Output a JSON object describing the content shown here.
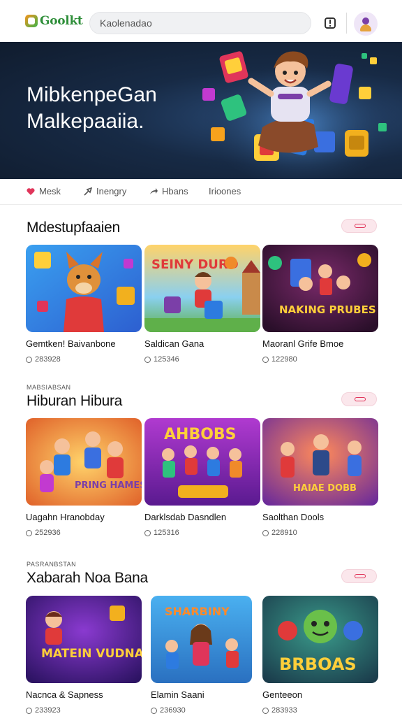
{
  "header": {
    "logo_text": "Goolkt",
    "search_placeholder": "Kaolenadao",
    "notification_icon": "bell-icon",
    "avatar_icon": "user-avatar"
  },
  "hero": {
    "title": "MibkenpeGan",
    "subtitle": "Malkepaaiia."
  },
  "tabs": [
    {
      "label": "Mesk",
      "icon": "heart-icon",
      "color": "#e0355a"
    },
    {
      "label": "Inengry",
      "icon": "arrow-icon",
      "color": "#555555"
    },
    {
      "label": "Hbans",
      "icon": "share-icon",
      "color": "#555555"
    },
    {
      "label": "Irioones",
      "icon": "",
      "color": "#555555"
    }
  ],
  "sections": [
    {
      "kicker": "",
      "title": "Mdestupfaaien",
      "cards": [
        {
          "title": "Gemtken! Baivanbone",
          "stat": "283928"
        },
        {
          "title": "Saldican Gana",
          "stat": "125346"
        },
        {
          "title": "Maoranl Grife Bmoe",
          "stat": "122980"
        }
      ]
    },
    {
      "kicker": "MABSIABSAN",
      "title": "Hiburan Hibura",
      "cards": [
        {
          "title": "Uagahn Hranobday",
          "stat": "252936"
        },
        {
          "title": "Darklsdab Dasndlen",
          "stat": "125316"
        },
        {
          "title": "Saolthan Dools",
          "stat": "228910"
        }
      ]
    },
    {
      "kicker": "PASRANBSTAN",
      "title": "Xabarah Noa Bana",
      "cards": [
        {
          "title": "Nacnca & Sapness",
          "stat": "233923"
        },
        {
          "title": "Elamin Saani",
          "stat": "236930"
        },
        {
          "title": "Genteeon",
          "stat": "283933"
        }
      ]
    }
  ],
  "thumb_text": {
    "s1c2": "SEINY DURD",
    "s1c3": "NAKING PRUBES",
    "s2c1": "PRING HAMES",
    "s2c2": "AHBOBS",
    "s2c3": "HAIAE DOBB",
    "s3c1": "MATEIN VUDNAS",
    "s3c2": "SHARBINY",
    "s3c3": "BRBOAS"
  },
  "colors": {
    "accent": "#e0355a",
    "hero_bg": "#172a45",
    "chip_bg": "#fbe7ec"
  }
}
